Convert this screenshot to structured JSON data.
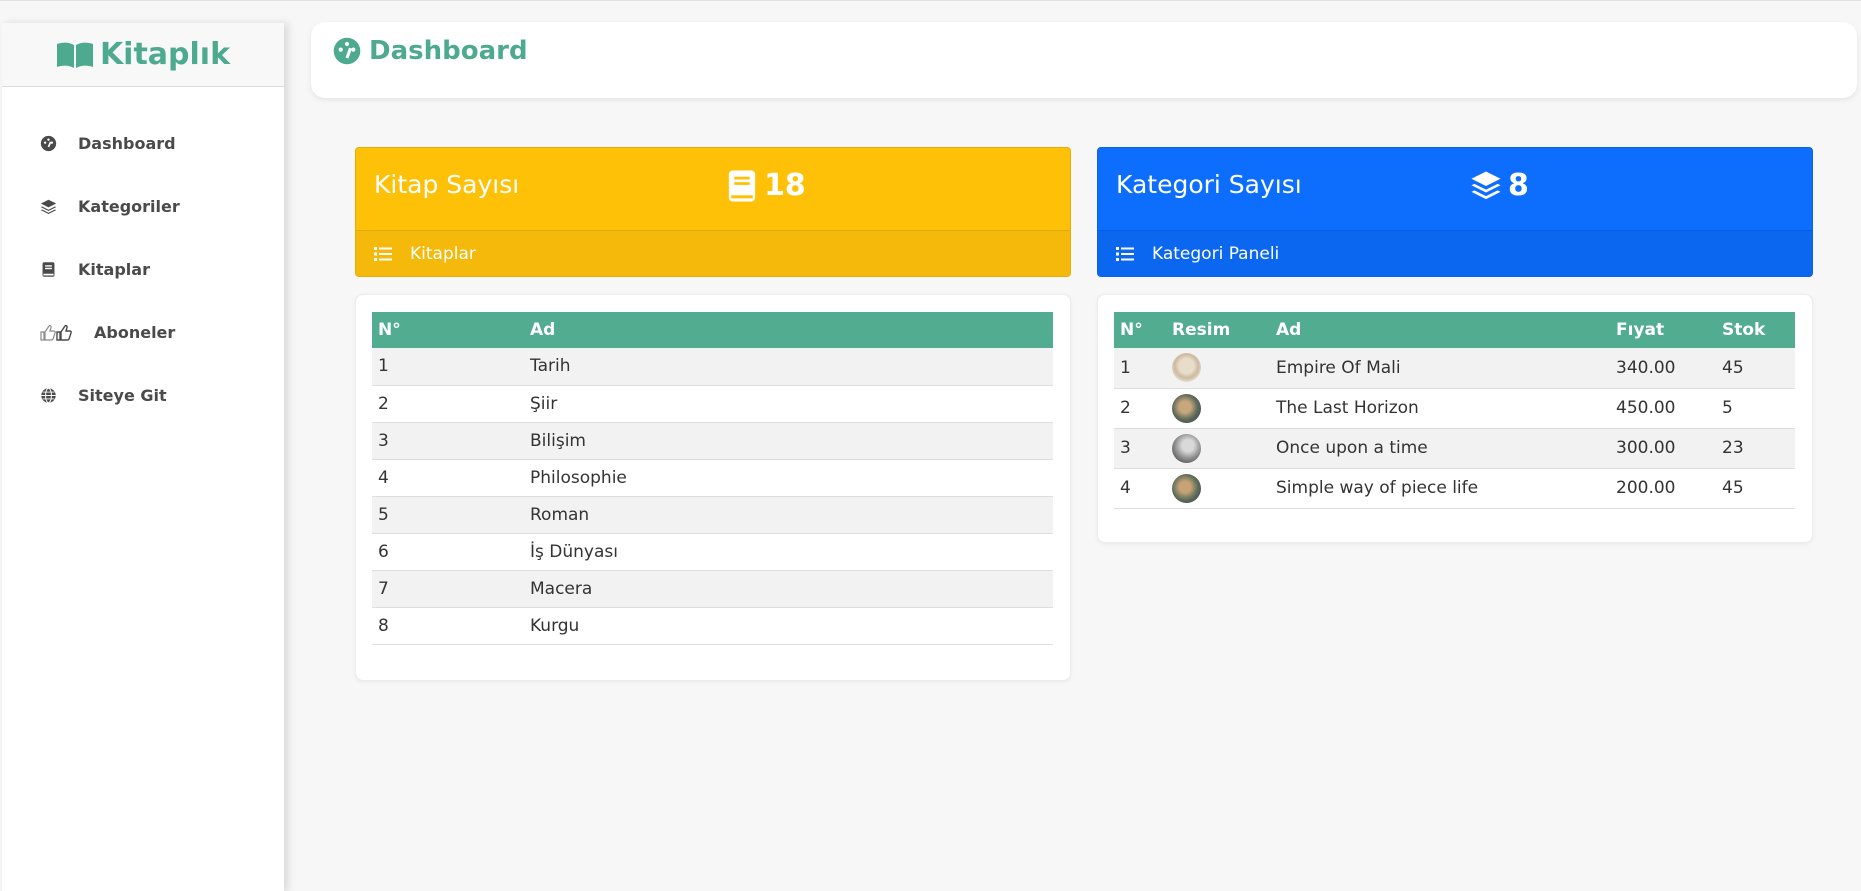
{
  "brand": {
    "name": "Kitaplık"
  },
  "sidebar": {
    "items": [
      {
        "label": "Dashboard",
        "icon": "dashboard-icon"
      },
      {
        "label": "Kategoriler",
        "icon": "layers-icon"
      },
      {
        "label": "Kitaplar",
        "icon": "book-icon"
      },
      {
        "label": "Aboneler",
        "icon": "thumbs-icon"
      },
      {
        "label": "Siteye Git",
        "icon": "globe-icon"
      }
    ]
  },
  "header": {
    "title": "Dashboard",
    "icon": "dashboard-icon"
  },
  "stats": {
    "books": {
      "title": "Kitap Sayısı",
      "count": "18",
      "link": "Kitaplar",
      "color": "#ffc107"
    },
    "categories": {
      "title": "Kategori Sayısı",
      "count": "8",
      "link": "Kategori Paneli",
      "color": "#0d6efd"
    }
  },
  "categories_table": {
    "columns": [
      "N°",
      "Ad"
    ],
    "rows": [
      [
        "1",
        "Tarih"
      ],
      [
        "2",
        "Şiir"
      ],
      [
        "3",
        "Bilişim"
      ],
      [
        "4",
        "Philosophie"
      ],
      [
        "5",
        "Roman"
      ],
      [
        "6",
        "İş Dünyası"
      ],
      [
        "7",
        "Macera"
      ],
      [
        "8",
        "Kurgu"
      ]
    ]
  },
  "books_table": {
    "columns": [
      "N°",
      "Resim",
      "Ad",
      "Fıyat",
      "Stok"
    ],
    "rows": [
      [
        "1",
        "",
        "Empire Of Mali",
        "340.00",
        "45"
      ],
      [
        "2",
        "",
        "The Last Horizon",
        "450.00",
        "5"
      ],
      [
        "3",
        "",
        "Once upon a time",
        "300.00",
        "23"
      ],
      [
        "4",
        "",
        "Simple way of piece life",
        "200.00",
        "45"
      ]
    ]
  },
  "colors": {
    "accent": "#4daa8e",
    "table_header": "#52ac8f"
  }
}
